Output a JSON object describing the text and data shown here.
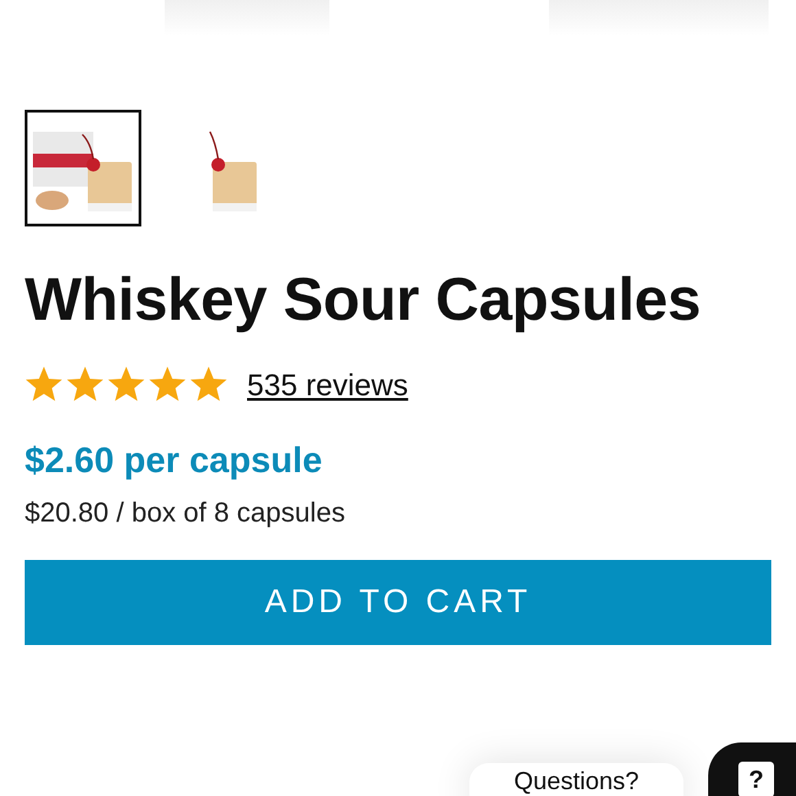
{
  "gallery": {
    "thumbnails": [
      {
        "kind": "picture",
        "selected": true
      },
      {
        "kind": "picture",
        "selected": false
      }
    ]
  },
  "product": {
    "title": "Whiskey Sour Capsules",
    "stars": 5,
    "reviews": "535 reviews",
    "unit_price": "$2.60 per capsule",
    "box_price": "$20.80 / box of 8 capsules",
    "add_to_cart": "ADD TO CART"
  },
  "chat": {
    "prompt": "Questions?",
    "button": "?"
  }
}
